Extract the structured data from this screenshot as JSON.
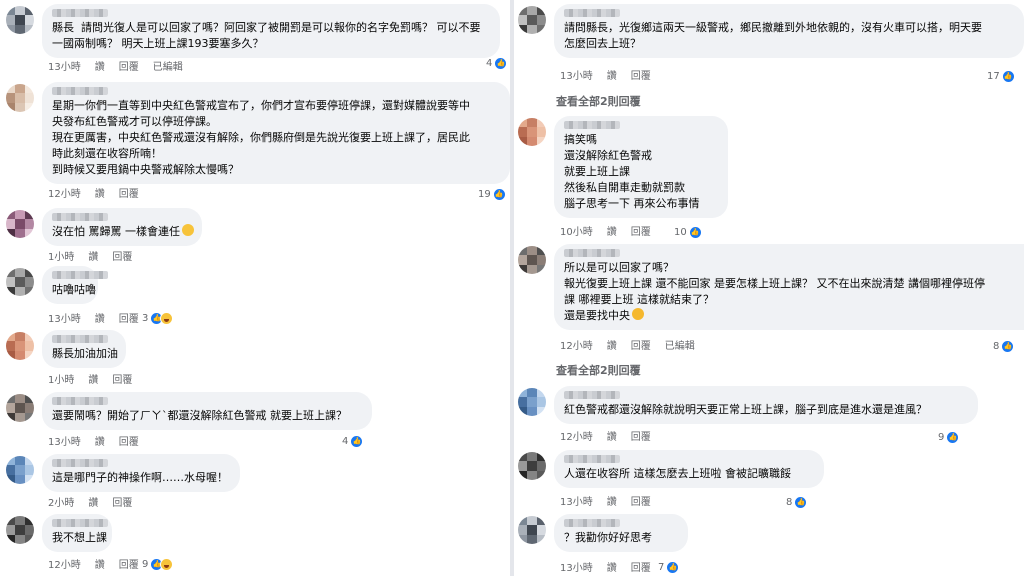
{
  "labels": {
    "like": "讚",
    "reply": "回覆",
    "edited": "已編輯"
  },
  "left": [
    {
      "lines": [
        "縣長  請問光復人是可以回家了嗎？阿回家了被開罰是可以報你的名字免罰嗎？ 可以不要",
        "一國兩制嗎？ 明天上班上課193要塞多久？"
      ],
      "time": "13小時",
      "edited": true,
      "likes": "4",
      "haha": false,
      "emoji": ""
    },
    {
      "lines": [
        "星期一你們一直等到中央紅色警戒宣布了，你們才宣布要停班停課，還對媒體說要等中",
        "央發布紅色警戒才可以停班停課。",
        "現在更厲害，中央紅色警戒還沒有解除，你們縣府倒是先說光復要上班上課了，居民此",
        "時此刻還在收容所喃！",
        "到時候又要甩鍋中央警戒解除太慢嗎？"
      ],
      "time": "12小時",
      "edited": false,
      "likes": "19",
      "haha": false,
      "emoji": ""
    },
    {
      "lines": [
        "沒在怕 罵歸罵 一樣會連任"
      ],
      "time": "1小時",
      "edited": false,
      "likes": "",
      "haha": false,
      "emoji": "smile-emoji"
    },
    {
      "lines": [
        "咕嚕咕嚕"
      ],
      "time": "13小時",
      "edited": false,
      "likes": "3",
      "haha": true,
      "emoji": ""
    },
    {
      "lines": [
        "縣長加油加油"
      ],
      "time": "1小時",
      "edited": false,
      "likes": "",
      "haha": false,
      "emoji": ""
    },
    {
      "lines": [
        "還要鬧嗎？開始了ㄏㄚˋ都還沒解除紅色警戒 就要上班上課？"
      ],
      "time": "13小時",
      "edited": false,
      "likes": "4",
      "haha": false,
      "emoji": ""
    },
    {
      "lines": [
        "這是哪門子的神操作啊……水母喔！"
      ],
      "time": "2小時",
      "edited": false,
      "likes": "",
      "haha": false,
      "emoji": ""
    },
    {
      "lines": [
        "我不想上課"
      ],
      "time": "12小時",
      "edited": false,
      "likes": "9",
      "haha": true,
      "emoji": ""
    }
  ],
  "right": [
    {
      "lines": [
        "請問縣長，光復鄉這兩天一級警戒，鄉民撤離到外地依親的，沒有火車可以搭，明天要",
        "怎麼回去上班？"
      ],
      "time": "13小時",
      "edited": false,
      "likes": "17",
      "haha": false,
      "emoji": ""
    },
    {
      "lines": [
        "搞笑嗎",
        "還沒解除紅色警戒",
        "就要上班上課",
        "然後私自開車走動就罰款",
        "腦子思考一下 再來公布事情"
      ],
      "time": "10小時",
      "edited": false,
      "likes": "10",
      "haha": false,
      "emoji": ""
    },
    {
      "lines": [
        "所以是可以回家了嗎？",
        "報光復要上班上課 還不能回家 是要怎樣上班上課？ 又不在出來說清楚 講個哪裡停班停",
        "課 哪裡要上班 這樣就結束了？",
        "還是要找中央"
      ],
      "time": "12小時",
      "edited": true,
      "likes": "8",
      "haha": false,
      "emoji": "think-emoji"
    },
    {
      "lines": [
        "紅色警戒都還沒解除就說明天要正常上班上課，腦子到底是進水還是進風？"
      ],
      "time": "12小時",
      "edited": false,
      "likes": "9",
      "haha": false,
      "emoji": ""
    },
    {
      "lines": [
        "人還在收容所 這樣怎麼去上班啦 會被記曠職餒"
      ],
      "time": "13小時",
      "edited": false,
      "likes": "8",
      "haha": false,
      "emoji": ""
    },
    {
      "lines": [
        "？我勸你好好思考"
      ],
      "time": "13小時",
      "edited": false,
      "likes": "7",
      "haha": false,
      "emoji": ""
    }
  ],
  "view_replies": [
    "查看全部2則回覆",
    "查看全部2則回覆"
  ]
}
